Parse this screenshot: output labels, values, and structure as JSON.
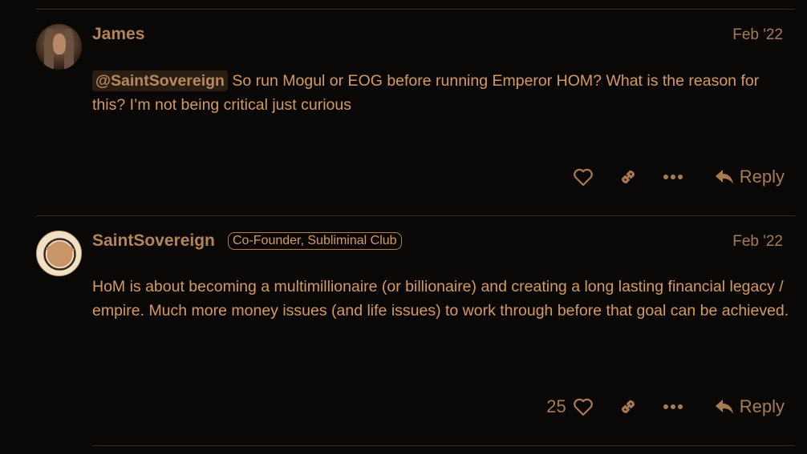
{
  "posts": [
    {
      "username": "James",
      "date": "Feb '22",
      "mention": "@SaintSovereign",
      "body": " So run Mogul or EOG before running Emperor HOM? What is the reason for this? I’m not being critical just curious",
      "likes": "",
      "reply_label": "Reply",
      "avatar_icon": "user-photo"
    },
    {
      "username": "SaintSovereign",
      "flair": "Co-Founder, Subliminal Club",
      "date": "Feb '22",
      "body": "HoM is about becoming a multimillionaire (or billionaire) and creating a long lasting financial legacy / empire. Much more money issues (and life issues) to work through before that goal can be achieved.",
      "likes": "25",
      "reply_label": "Reply",
      "avatar_icon": "brush-circle-logo"
    }
  ],
  "icons": {
    "like": "heart-icon",
    "copy_link": "link-icon",
    "more": "ellipsis-icon",
    "reply": "reply-arrow-icon"
  },
  "colors": {
    "background": "#0a0806",
    "accent": "#d49a63",
    "muted": "#a87b52",
    "divider": "#3b2c1c"
  }
}
